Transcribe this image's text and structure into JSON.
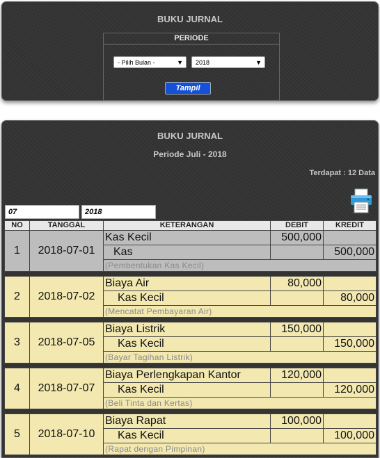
{
  "filter_panel": {
    "title": "BUKU JURNAL",
    "period_label": "PERIODE",
    "month_select": "- Pilih Bulan -",
    "year_select": "2018",
    "submit_label": "Tampil"
  },
  "journal_panel": {
    "title": "BUKU JURNAL",
    "subtitle": "Periode Juli - 2018",
    "count_text": "Terdapat : 12 Data",
    "printer_icon": "printer-icon",
    "month_input": "07",
    "year_input": "2018",
    "columns": [
      "NO",
      "TANGGAL",
      "KETERANGAN",
      "DEBIT",
      "KREDIT"
    ],
    "entries": [
      {
        "no": "1",
        "date": "2018-07-01",
        "debit_account": "Kas Kecil",
        "debit": "500,000",
        "credit_account": "Kas",
        "credit": "500,000",
        "note": "(Pembentukan Kas Kecil)",
        "color": "gray"
      },
      {
        "no": "2",
        "date": "2018-07-02",
        "debit_account": "Biaya Air",
        "debit": "80,000",
        "credit_account": "Kas Kecil",
        "credit": "80,000",
        "note": "(Mencatat Pembayaran Air)",
        "color": "yellow"
      },
      {
        "no": "3",
        "date": "2018-07-05",
        "debit_account": "Biaya Listrik",
        "debit": "150,000",
        "credit_account": "Kas Kecil",
        "credit": "150,000",
        "note": "(Bayar Tagihan Listrik)",
        "color": "yellow"
      },
      {
        "no": "4",
        "date": "2018-07-07",
        "debit_account": "Biaya Perlengkapan Kantor",
        "debit": "120,000",
        "credit_account": "Kas Kecil",
        "credit": "120,000",
        "note": "(Beli Tinta dan Kertas)",
        "color": "yellow"
      },
      {
        "no": "5",
        "date": "2018-07-10",
        "debit_account": "Biaya Rapat",
        "debit": "100,000",
        "credit_account": "Kas Kecil",
        "credit": "100,000",
        "note": "(Rapat dengan Pimpinan)",
        "color": "yellow"
      }
    ]
  },
  "colors": {
    "panel_bg": "#333333",
    "header_bg": "#e8e8e8",
    "row_gray": "#bdbdbd",
    "row_yellow": "#f2e8b0",
    "button_blue": "#1550d6"
  }
}
